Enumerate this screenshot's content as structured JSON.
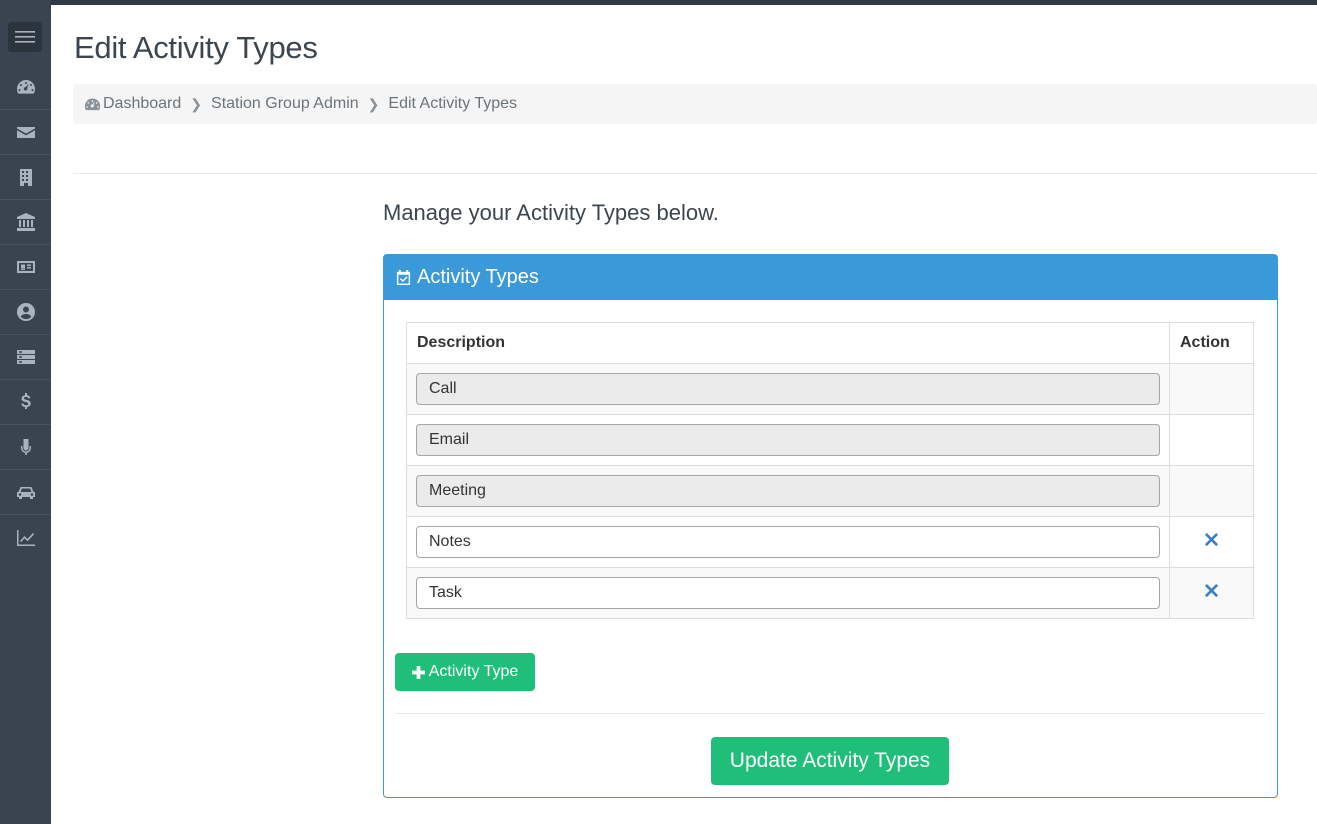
{
  "page": {
    "title": "Edit Activity Types",
    "intro": "Manage your Activity Types below."
  },
  "breadcrumb": {
    "items": [
      "Dashboard",
      "Station Group Admin",
      "Edit Activity Types"
    ]
  },
  "sidebar": {
    "icons": [
      "dashboard-icon",
      "envelope-icon",
      "building-icon",
      "bank-icon",
      "id-card-icon",
      "user-circle-icon",
      "server-icon",
      "dollar-icon",
      "microphone-icon",
      "car-icon",
      "line-chart-icon"
    ]
  },
  "panel": {
    "title": "Activity Types",
    "columns": {
      "description": "Description",
      "action": "Action"
    },
    "rows": [
      {
        "value": "Call",
        "readonly": true
      },
      {
        "value": "Email",
        "readonly": true
      },
      {
        "value": "Meeting",
        "readonly": true
      },
      {
        "value": "Notes",
        "readonly": false
      },
      {
        "value": "Task",
        "readonly": false
      }
    ],
    "add_label": "Activity Type",
    "update_label": "Update Activity Types"
  },
  "colors": {
    "accent": "#3a9ad9",
    "success": "#1fbf7a",
    "sidebar": "#3a4450"
  }
}
